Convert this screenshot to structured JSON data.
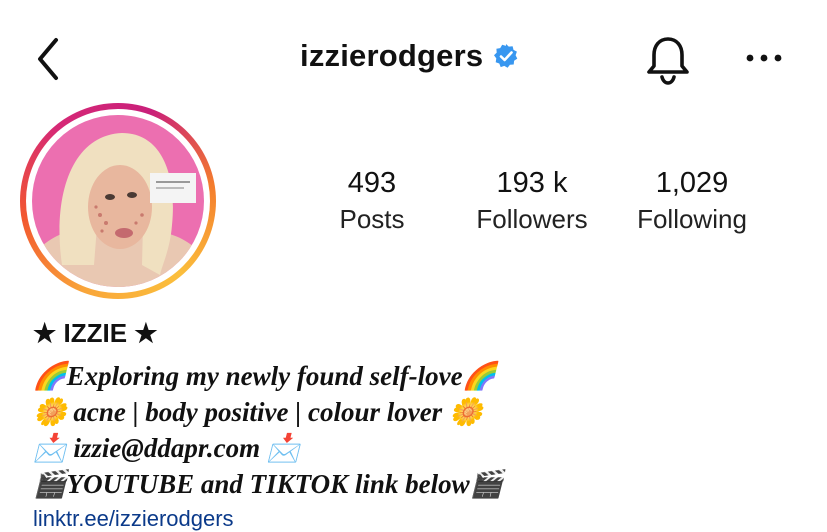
{
  "header": {
    "username": "izzierodgers",
    "verified": true,
    "icons": [
      "back-chevron-icon",
      "verified-badge-icon",
      "bell-icon",
      "more-dots-icon"
    ]
  },
  "stats": [
    {
      "value": "493",
      "label": "Posts"
    },
    {
      "value": "193 k",
      "label": "Followers"
    },
    {
      "value": "1,029",
      "label": "Following"
    }
  ],
  "profile": {
    "name": "★ IZZIE ★",
    "bio_lines": [
      "🌈Exploring my newly found self-love🌈",
      "🌼 acne | body positive | colour lover 🌼",
      "📩 izzie@ddapr.com 📩",
      "🎬YOUTUBE and TIKTOK link below🎬"
    ],
    "link": "linktr.ee/izzierodgers"
  },
  "colors": {
    "verified": "#3897f0",
    "ring_start": "#f9a63a",
    "ring_mid": "#d62976",
    "link": "#0b3a8a",
    "text": "#111111"
  }
}
